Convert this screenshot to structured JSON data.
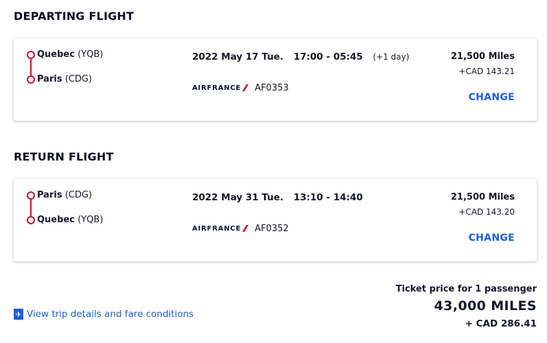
{
  "departing": {
    "section_title": "DEPARTING FLIGHT",
    "origin_city": "Quebec",
    "origin_code": "(YQB)",
    "destination_city": "Paris",
    "destination_code": "(CDG)",
    "date": "2022 May 17 Tue.",
    "time": "17:00 - 05:45",
    "next_day": "(+1 day)",
    "airline_logo_text": "AIRFRANCE",
    "flight_number": "AF0353",
    "miles": "21,500 Miles",
    "cad": "+CAD 143.21",
    "change_label": "CHANGE"
  },
  "return": {
    "section_title": "RETURN FLIGHT",
    "origin_city": "Paris",
    "origin_code": "(CDG)",
    "destination_city": "Quebec",
    "destination_code": "(YQB)",
    "date": "2022 May 31 Tue.",
    "time": "13:10 - 14:40",
    "airline_logo_text": "AIRFRANCE",
    "flight_number": "AF0352",
    "miles": "21,500 Miles",
    "cad": "+CAD 143.20",
    "change_label": "CHANGE"
  },
  "footer": {
    "trip_details_link": "View trip details and fare conditions",
    "ticket_price_label": "Ticket price for 1 passenger",
    "total_miles": "43,000 MILES",
    "total_cad": "+ CAD 286.41"
  },
  "colors": {
    "accent": "#1b5ed1",
    "route": "#c8102e",
    "brand_navy": "#051039"
  },
  "icons": {
    "route_marker": "circle-outline-icon",
    "airline_mark": "air-france-stripe-icon",
    "trip_details": "plane-document-icon"
  }
}
